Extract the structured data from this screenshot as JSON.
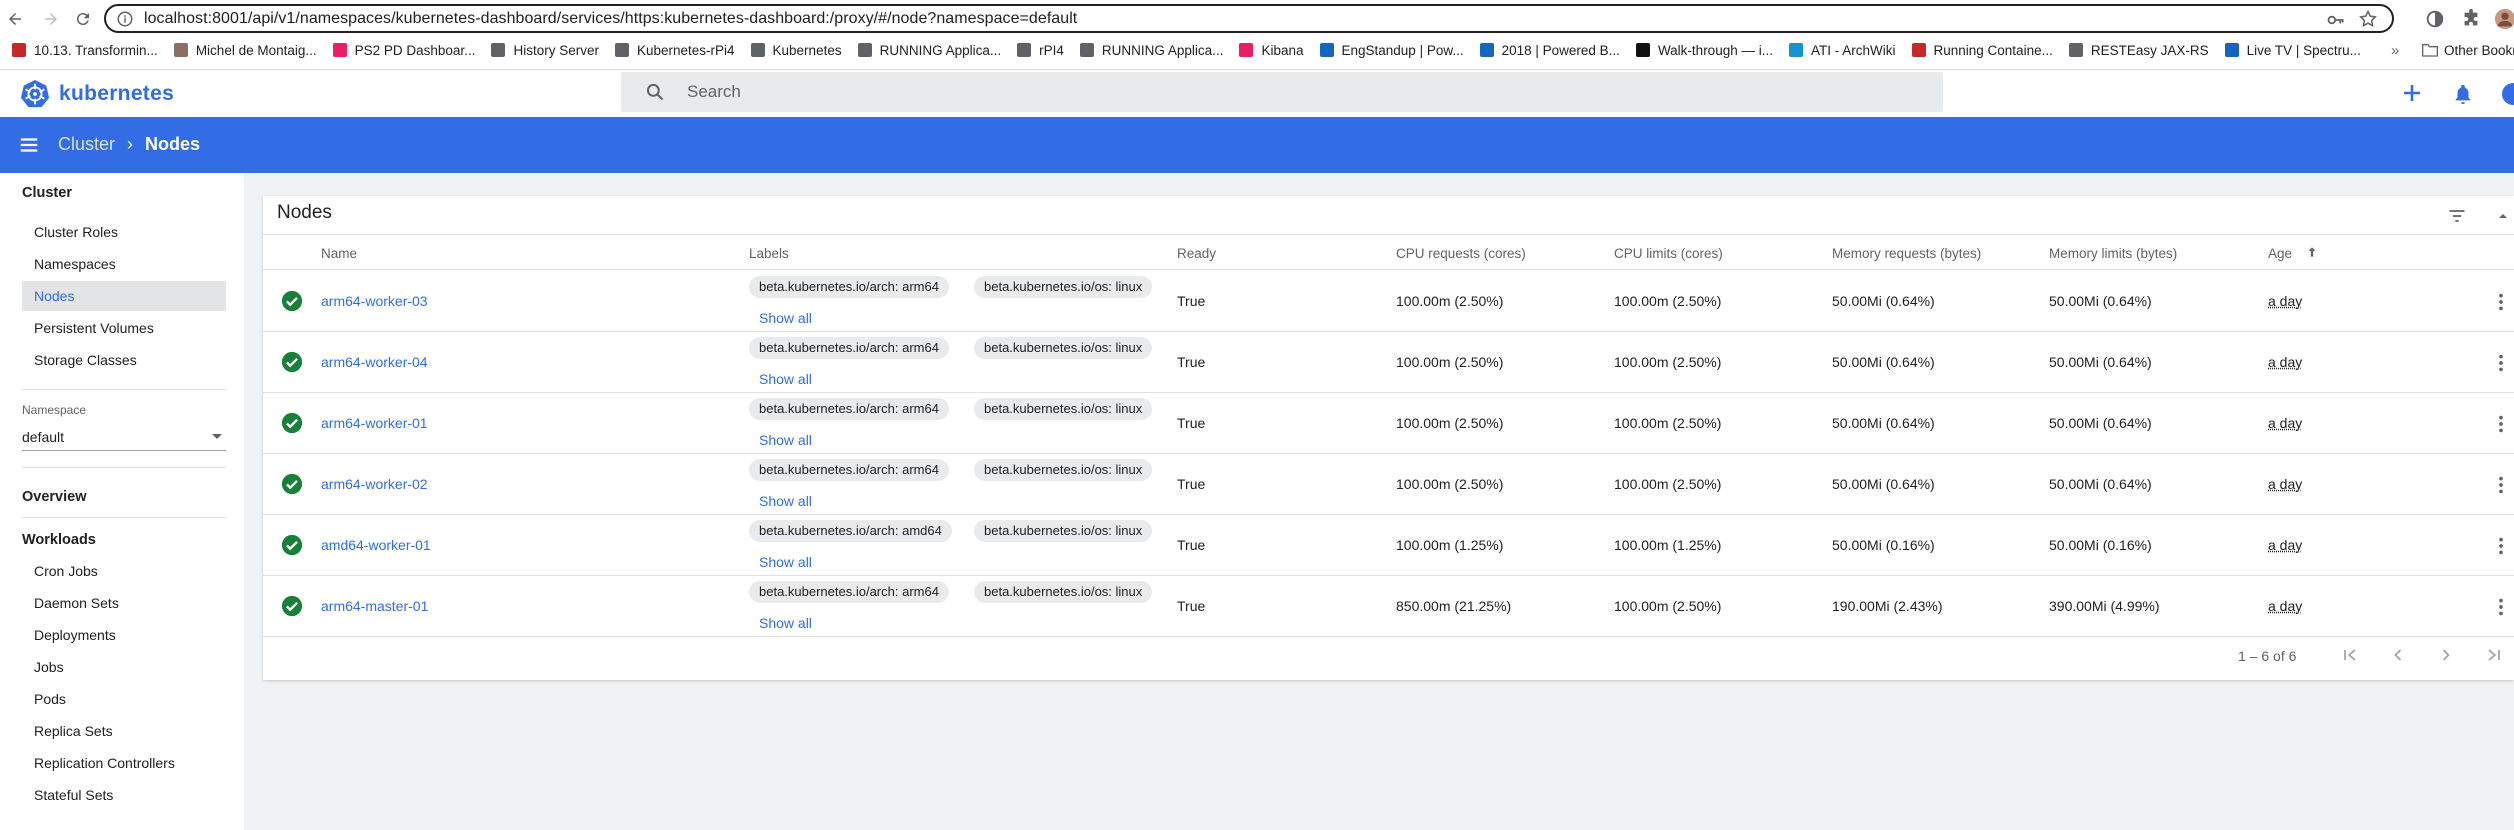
{
  "browser": {
    "url": "localhost:8001/api/v1/namespaces/kubernetes-dashboard/services/https:kubernetes-dashboard:/proxy/#/node?namespace=default",
    "bookmarks": [
      {
        "label": "10.13. Transformin...",
        "color": "#c62828"
      },
      {
        "label": "Michel de Montaig...",
        "color": "#8d6e63"
      },
      {
        "label": "PS2 PD Dashboar...",
        "color": "#e91e63"
      },
      {
        "label": "History Server",
        "color": "#5f6368"
      },
      {
        "label": "Kubernetes-rPi4",
        "color": "#5f6368"
      },
      {
        "label": "Kubernetes",
        "color": "#5f6368"
      },
      {
        "label": "RUNNING Applica...",
        "color": "#5f6368"
      },
      {
        "label": "rPI4",
        "color": "#5f6368"
      },
      {
        "label": "RUNNING Applica...",
        "color": "#5f6368"
      },
      {
        "label": "Kibana",
        "color": "#e91e63"
      },
      {
        "label": "EngStandup | Pow...",
        "color": "#1565c0"
      },
      {
        "label": "2018 | Powered B...",
        "color": "#1565c0"
      },
      {
        "label": "Walk-through — i...",
        "color": "#111111"
      },
      {
        "label": "ATI - ArchWiki",
        "color": "#1793d1"
      },
      {
        "label": "Running Containe...",
        "color": "#c62828"
      },
      {
        "label": "RESTEasy JAX-RS",
        "color": "#5f6368"
      },
      {
        "label": "Live TV | Spectru...",
        "color": "#1565c0"
      }
    ],
    "more_bookmarks": "»",
    "other_bookmarks": "Other Bookm"
  },
  "app": {
    "name": "kubernetes",
    "search_placeholder": "Search",
    "breadcrumb": {
      "parent": "Cluster",
      "sep": "›",
      "current": "Nodes"
    },
    "accent": "#326de6"
  },
  "sidebar": {
    "cluster_heading": "Cluster",
    "cluster_items": [
      "Cluster Roles",
      "Namespaces",
      "Nodes",
      "Persistent Volumes",
      "Storage Classes"
    ],
    "active_item": "Nodes",
    "namespace_label": "Namespace",
    "namespace_value": "default",
    "overview": "Overview",
    "workloads_heading": "Workloads",
    "workload_items": [
      "Cron Jobs",
      "Daemon Sets",
      "Deployments",
      "Jobs",
      "Pods",
      "Replica Sets",
      "Replication Controllers",
      "Stateful Sets"
    ]
  },
  "nodes": {
    "title": "Nodes",
    "columns": [
      "Name",
      "Labels",
      "Ready",
      "CPU requests (cores)",
      "CPU limits (cores)",
      "Memory requests (bytes)",
      "Memory limits (bytes)",
      "Age"
    ],
    "show_all": "Show all",
    "rows": [
      {
        "name": "arm64-worker-03",
        "label1": "beta.kubernetes.io/arch: arm64",
        "label2": "beta.kubernetes.io/os: linux",
        "ready": "True",
        "cpu_req": "100.00m (2.50%)",
        "cpu_lim": "100.00m (2.50%)",
        "mem_req": "50.00Mi (0.64%)",
        "mem_lim": "50.00Mi (0.64%)",
        "age": "a day"
      },
      {
        "name": "arm64-worker-04",
        "label1": "beta.kubernetes.io/arch: arm64",
        "label2": "beta.kubernetes.io/os: linux",
        "ready": "True",
        "cpu_req": "100.00m (2.50%)",
        "cpu_lim": "100.00m (2.50%)",
        "mem_req": "50.00Mi (0.64%)",
        "mem_lim": "50.00Mi (0.64%)",
        "age": "a day"
      },
      {
        "name": "arm64-worker-01",
        "label1": "beta.kubernetes.io/arch: arm64",
        "label2": "beta.kubernetes.io/os: linux",
        "ready": "True",
        "cpu_req": "100.00m (2.50%)",
        "cpu_lim": "100.00m (2.50%)",
        "mem_req": "50.00Mi (0.64%)",
        "mem_lim": "50.00Mi (0.64%)",
        "age": "a day"
      },
      {
        "name": "arm64-worker-02",
        "label1": "beta.kubernetes.io/arch: arm64",
        "label2": "beta.kubernetes.io/os: linux",
        "ready": "True",
        "cpu_req": "100.00m (2.50%)",
        "cpu_lim": "100.00m (2.50%)",
        "mem_req": "50.00Mi (0.64%)",
        "mem_lim": "50.00Mi (0.64%)",
        "age": "a day"
      },
      {
        "name": "amd64-worker-01",
        "label1": "beta.kubernetes.io/arch: amd64",
        "label2": "beta.kubernetes.io/os: linux",
        "ready": "True",
        "cpu_req": "100.00m (1.25%)",
        "cpu_lim": "100.00m (1.25%)",
        "mem_req": "50.00Mi (0.16%)",
        "mem_lim": "50.00Mi (0.16%)",
        "age": "a day"
      },
      {
        "name": "arm64-master-01",
        "label1": "beta.kubernetes.io/arch: arm64",
        "label2": "beta.kubernetes.io/os: linux",
        "ready": "True",
        "cpu_req": "850.00m (21.25%)",
        "cpu_lim": "100.00m (2.50%)",
        "mem_req": "190.00Mi (2.43%)",
        "mem_lim": "390.00Mi (4.99%)",
        "age": "a day"
      }
    ],
    "page_range": "1 – 6 of 6",
    "status_color": "#188038"
  }
}
